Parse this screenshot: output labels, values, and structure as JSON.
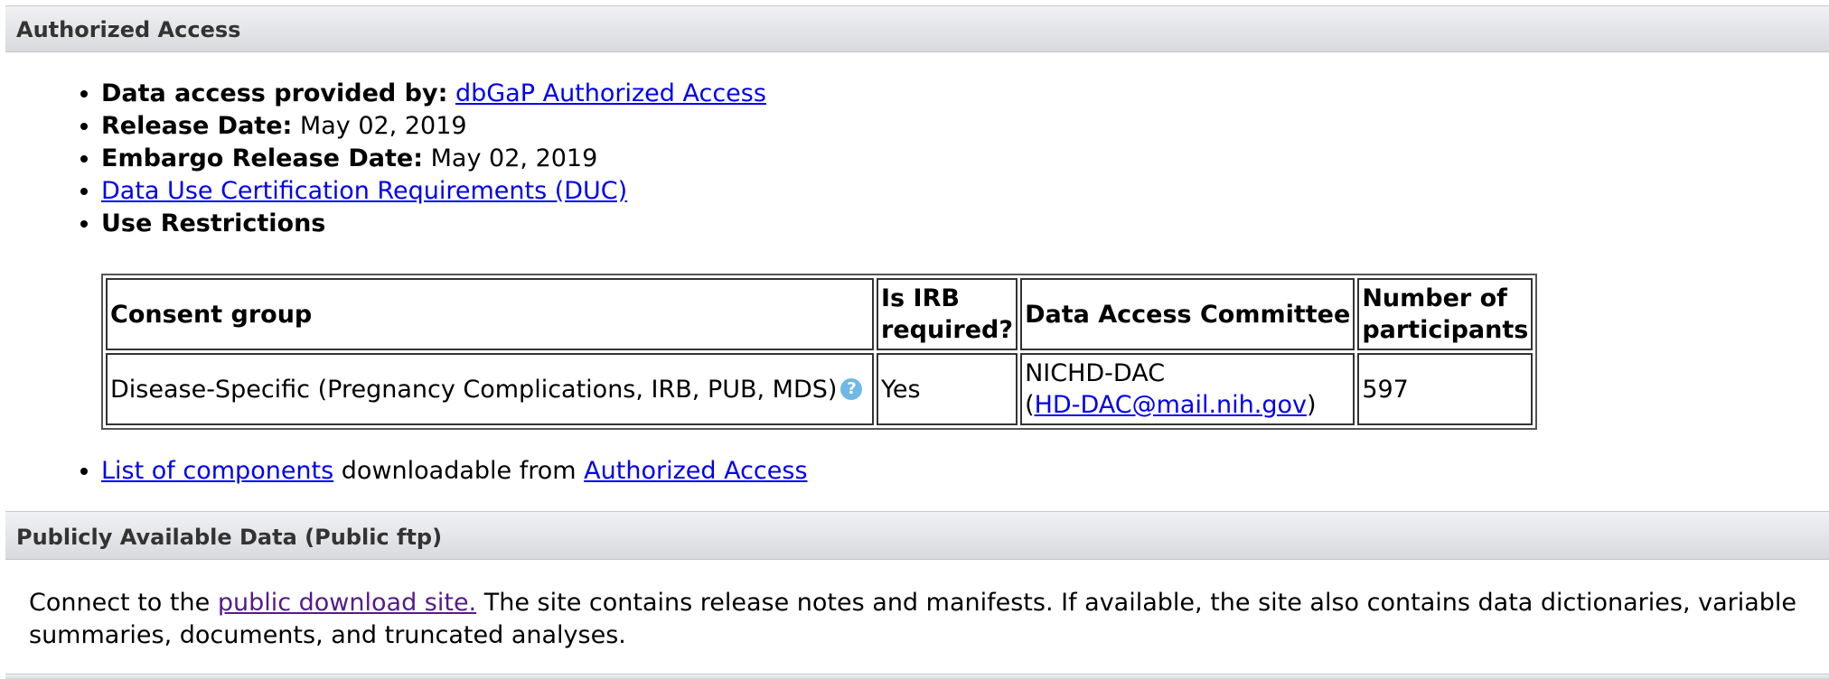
{
  "authorized_access": {
    "heading": "Authorized Access",
    "data_access_label": "Data access provided by:",
    "data_access_link": "dbGaP Authorized Access",
    "release_date_label": "Release Date:",
    "release_date_value": "May 02, 2019",
    "embargo_label": "Embargo Release Date:",
    "embargo_value": "May 02, 2019",
    "duc_link": "Data Use Certification Requirements (DUC)",
    "use_restrictions_label": "Use Restrictions",
    "table": {
      "headers": {
        "consent_group": "Consent group",
        "irb_line1": "Is IRB",
        "irb_line2": "required?",
        "dac": "Data Access Committee",
        "participants_line1": "Number of",
        "participants_line2": "participants"
      },
      "row": {
        "consent_group": "Disease-Specific (Pregnancy Complications, IRB, PUB, MDS)",
        "help_icon": "question-circle-icon",
        "irb": "Yes",
        "dac_name": "NICHD-DAC",
        "dac_open_paren": "(",
        "dac_email": "HD-DAC@mail.nih.gov",
        "dac_close_paren": ")",
        "participants": "597"
      }
    },
    "components_link": "List of components",
    "components_middle": "downloadable from",
    "authorized_link": "Authorized Access"
  },
  "public_data": {
    "heading": "Publicly Available Data (Public ftp)",
    "intro": "Connect to the",
    "download_link": "public download site.",
    "description": "The site contains release notes and manifests. If available, the site also contains data dictionaries, variable summaries, documents, and truncated analyses."
  },
  "colors": {
    "link": "#0000ee",
    "visited_link": "#551a8b",
    "section_bar": "#e2e3e6",
    "help_icon": "#6fb8e8"
  }
}
